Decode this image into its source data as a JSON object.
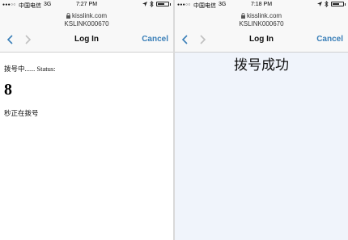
{
  "left": {
    "status_bar": {
      "carrier": "中国电信",
      "network": "3G",
      "time": "7:27 PM"
    },
    "header": {
      "url": "kisslink.com",
      "ssid": "KSLINK000670",
      "title": "Log In",
      "cancel": "Cancel"
    },
    "content": {
      "line1": "拨号中...... Status:",
      "count": "8",
      "line3": "秒正在拨号"
    }
  },
  "right": {
    "status_bar": {
      "carrier": "中国电信",
      "network": "3G",
      "time": "7:18 PM"
    },
    "header": {
      "url": "kisslink.com",
      "ssid": "KSLINK000670",
      "title": "Log In",
      "cancel": "Cancel"
    },
    "content": {
      "success": "拨号成功"
    }
  },
  "colors": {
    "accent": "#3a7fb8",
    "right_background": "#f0f4fb"
  },
  "icons": [
    "signal-dots-icon",
    "lock-icon",
    "chevron-left-icon",
    "chevron-right-icon",
    "location-arrow-icon",
    "bluetooth-icon",
    "battery-icon"
  ]
}
